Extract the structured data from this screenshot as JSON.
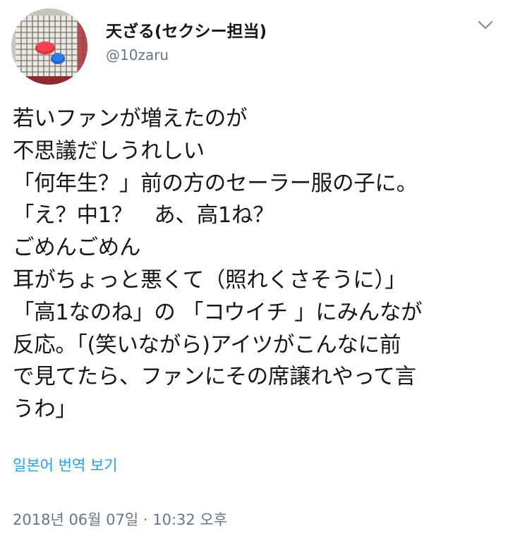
{
  "author": {
    "display_name": "天ざる(セクシー担当)",
    "handle": "@10zaru",
    "avatar_icon": "avatar-photo-icon"
  },
  "menu": {
    "icon": "chevron-down-icon"
  },
  "tweet": {
    "text": "若いファンが増えたのが\n不思議だしうれしい\n「何年生？」前の方のセーラー服の子に。\n「え？中1？　あ、高1ね？\nごめんごめん\n耳がちょっと悪くて（照れくさそうに）」\n「高1なのね」の 「コウイチ 」にみんなが\n反応。「(笑いながら)アイツがこんなに前\nで見てたら、ファンにその席譲れやって言\nうわ」",
    "translate_label": "일본어 번역 보기",
    "timestamp": "2018년 06월 07일 · 10:32 오후"
  },
  "colors": {
    "text": "#14171a",
    "secondary": "#657786",
    "link": "#1da1f2"
  }
}
